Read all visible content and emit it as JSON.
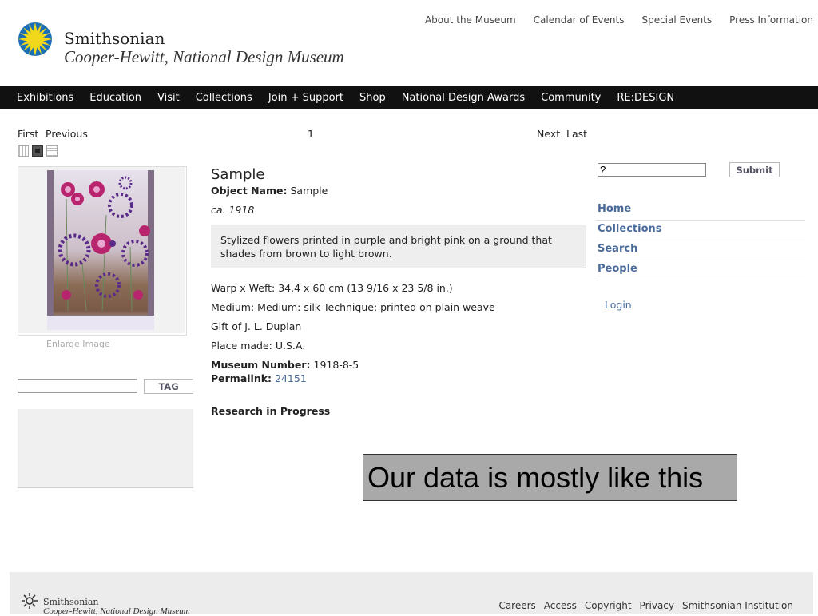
{
  "brand": {
    "name": "Smithsonian",
    "subtitle": "Cooper-Hewitt, National Design Museum"
  },
  "top_links": [
    "About the Museum",
    "Calendar of Events",
    "Special Events",
    "Press Information"
  ],
  "nav": [
    "Exhibitions",
    "Education",
    "Visit",
    "Collections",
    "Join + Support",
    "Shop",
    "National Design Awards",
    "Community",
    "RE:DESIGN"
  ],
  "pager": {
    "first": "First",
    "previous": "Previous",
    "page": "1",
    "next": "Next",
    "last": "Last"
  },
  "image": {
    "enlarge": "Enlarge Image"
  },
  "tag": {
    "button": "TAG"
  },
  "object": {
    "title": "Sample",
    "name_label": "Object Name:",
    "name_value": "Sample",
    "date": "ca. 1918",
    "description": "Stylized flowers printed in purple and bright pink on a ground that shades from brown to light brown.",
    "dimensions": "Warp x Weft: 34.4 x 60 cm (13 9/16 x 23 5/8 in.)",
    "medium": "Medium: Medium: silk Technique: printed on plain weave",
    "credit": "Gift of J. L. Duplan",
    "place": "Place made: U.S.A.",
    "number_label": "Museum Number:",
    "number_value": "1918-8-5",
    "permalink_label": "Permalink:",
    "permalink_value": "24151",
    "research": "Research in Progress"
  },
  "search": {
    "submit": "Submit",
    "value": "?"
  },
  "sidenav": [
    "Home",
    "Collections",
    "Search",
    "People"
  ],
  "login": "Login",
  "overlay_text": "Our data is mostly like this",
  "footer": {
    "brand": "Smithsonian",
    "subtitle": "Cooper-Hewitt, National Design Museum",
    "links": [
      "Careers",
      "Access",
      "Copyright",
      "Privacy",
      "Smithsonian Institution"
    ]
  },
  "colors": {
    "nav_bg": "#111111",
    "link": "#4a6a99",
    "sun_yellow": "#f2d81a",
    "sun_blue": "#1c6fb5"
  }
}
